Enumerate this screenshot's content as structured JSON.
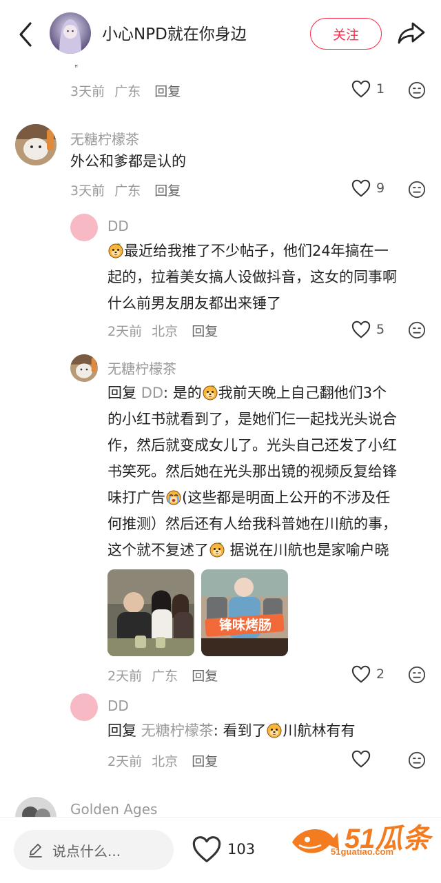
{
  "header": {
    "title": "小心NPD就在你身边",
    "follow_label": "关注",
    "small_mark": "ꟸ"
  },
  "comments": [
    {
      "meta_time": "3天前",
      "meta_loc": "广东",
      "reply_label": "回复",
      "likes": "1"
    },
    {
      "username": "无糖柠檬茶",
      "text": "外公和爹都是认的",
      "meta_time": "3天前",
      "meta_loc": "广东",
      "reply_label": "回复",
      "likes": "9"
    },
    {
      "username": "DD",
      "lines": [
        "最近给我推了不少帖子，他们24年搞在一",
        "起的，拉着美女搞人设做抖音，这女的同事啊",
        "什么前男友朋友都出来锤了"
      ],
      "meta_time": "2天前",
      "meta_loc": "北京",
      "reply_label": "回复",
      "likes": "5"
    },
    {
      "username": "无糖柠檬茶",
      "reply_prefix": "回复 ",
      "reply_to": "DD",
      "line1_a": ": 是的",
      "line1_b": "我前天晚上自己翻他们3个",
      "lines": [
        "的小红书就看到了，是她们仨一起找光头说合",
        "作，然后就变成女儿了。光头自己还发了小红",
        "书笑死。然后她在光头那出镜的视频反复给锋"
      ],
      "line5_a": "味打广告",
      "line5_b": "(这些都是明面上公开的不涉及任",
      "line6": "何推测）然后还有人给我科普她在川航的事，",
      "line7_a": "这个就不复述了",
      "line7_b": " 据说在川航也是家喻户晓",
      "image2_text": "锋味烤肠",
      "meta_time": "2天前",
      "meta_loc": "广东",
      "reply_label": "回复",
      "likes": "2"
    },
    {
      "username": "DD",
      "reply_prefix": "回复 ",
      "reply_to": "无糖柠檬茶",
      "text_a": ": 看到了",
      "text_b": "川航林有有",
      "meta_time": "2天前",
      "meta_loc": "北京",
      "reply_label": "回复",
      "likes": ""
    },
    {
      "username": "Golden Ages"
    }
  ],
  "bottom": {
    "placeholder": "说点什么...",
    "like_count": "103",
    "watermark_text": "51瓜条",
    "watermark_url": "51guatiao.com"
  },
  "colors": {
    "accent": "#ff2e4d",
    "pink_avatar": "#f7b9c4",
    "watermark": "#f47c20"
  }
}
